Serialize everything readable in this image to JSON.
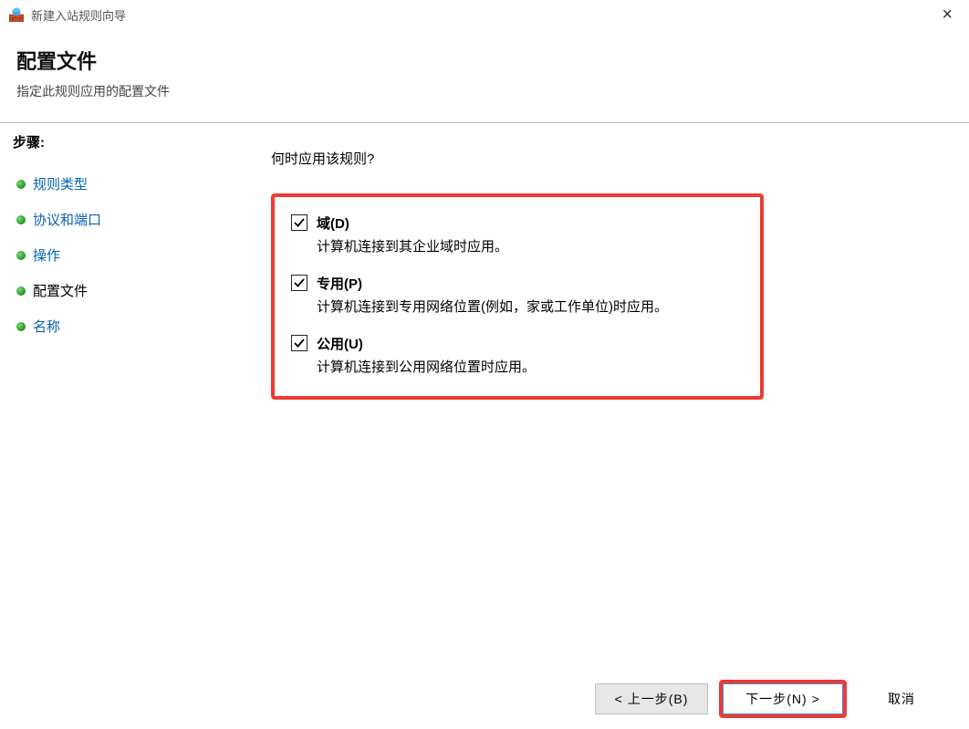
{
  "window": {
    "title": "新建入站规则向导"
  },
  "header": {
    "title": "配置文件",
    "subtitle": "指定此规则应用的配置文件"
  },
  "sidebar": {
    "steps_label": "步骤:",
    "items": [
      {
        "label": "规则类型",
        "state": "link"
      },
      {
        "label": "协议和端口",
        "state": "link"
      },
      {
        "label": "操作",
        "state": "link"
      },
      {
        "label": "配置文件",
        "state": "current"
      },
      {
        "label": "名称",
        "state": "link"
      }
    ]
  },
  "content": {
    "question": "何时应用该规则?",
    "options": [
      {
        "title": "域(D)",
        "desc": "计算机连接到其企业域时应用。",
        "checked": true
      },
      {
        "title": "专用(P)",
        "desc": "计算机连接到专用网络位置(例如，家或工作单位)时应用。",
        "checked": true
      },
      {
        "title": "公用(U)",
        "desc": "计算机连接到公用网络位置时应用。",
        "checked": true
      }
    ]
  },
  "footer": {
    "back": "< 上一步(B)",
    "next": "下一步(N) >",
    "cancel": "取消"
  }
}
